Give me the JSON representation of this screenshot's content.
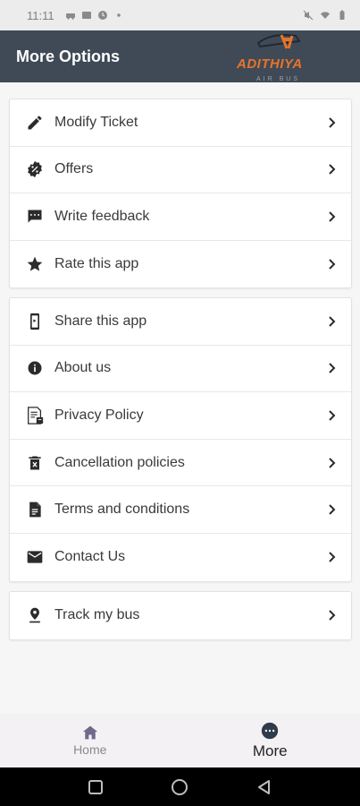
{
  "status_bar": {
    "time": "11:11",
    "left_icons": [
      "car-icon",
      "photo-icon",
      "clock-icon",
      "dot-icon"
    ],
    "right_icons": [
      "mute-icon",
      "wifi-icon",
      "battery-icon"
    ]
  },
  "app_bar": {
    "title": "More Options",
    "logo": {
      "brand": "ADITHIYA",
      "sub": "AIR BUS",
      "brand_color": "#e8742a"
    },
    "background": "#3f4a56"
  },
  "groups": [
    {
      "items": [
        {
          "label": "Modify Ticket",
          "icon": "pencil-icon"
        },
        {
          "label": "Offers",
          "icon": "offer-badge-icon"
        },
        {
          "label": "Write feedback",
          "icon": "feedback-icon"
        },
        {
          "label": "Rate this app",
          "icon": "star-icon"
        }
      ]
    },
    {
      "items": [
        {
          "label": "Share this app",
          "icon": "share-phone-icon"
        },
        {
          "label": "About us",
          "icon": "info-icon"
        },
        {
          "label": "Privacy Policy",
          "icon": "privacy-doc-icon"
        },
        {
          "label": "Cancellation policies",
          "icon": "cancel-trash-icon"
        },
        {
          "label": "Terms and conditions",
          "icon": "document-icon"
        },
        {
          "label": "Contact Us",
          "icon": "mail-icon"
        }
      ]
    },
    {
      "items": [
        {
          "label": "Track my bus",
          "icon": "location-pin-icon"
        }
      ]
    }
  ],
  "bottom_nav": {
    "home": {
      "label": "Home",
      "icon": "home-icon",
      "color": "#8a8a8a"
    },
    "more": {
      "label": "More",
      "icon": "more-dots-icon",
      "active": true,
      "color": "#222222"
    }
  },
  "system_nav": {
    "icons": [
      "recents-icon",
      "home-circle-icon",
      "back-icon"
    ]
  }
}
